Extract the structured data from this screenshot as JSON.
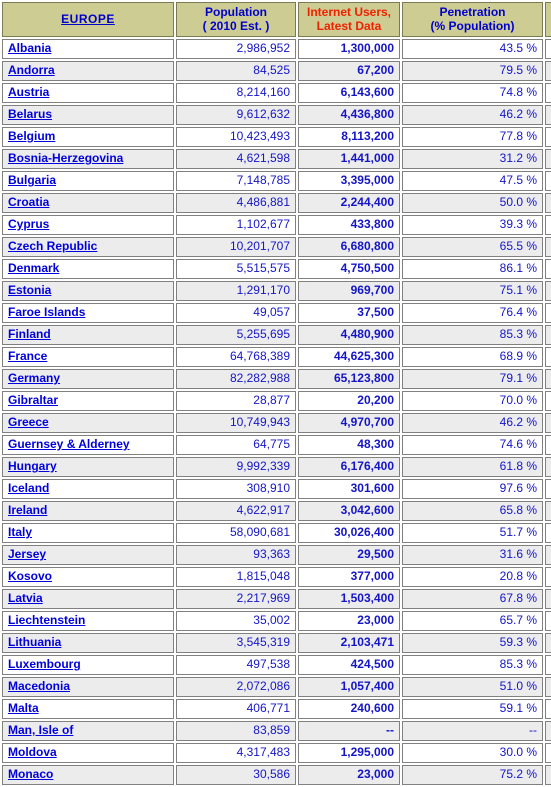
{
  "table": {
    "headers": {
      "region": "EUROPE",
      "population_line1": "Population",
      "population_line2": "( 2010 Est. )",
      "users_line1": "Internet Users,",
      "users_line2": "Latest Data",
      "penetration_line1": "Penetration",
      "penetration_line2": "(% Population)"
    },
    "colors": {
      "header_bg": "#cdcc93",
      "header_blue": "#0000cc",
      "header_red": "#ee2200",
      "link_blue": "#0000dd",
      "value_blue": "#2222cc",
      "alt_row_bg": "#ececec",
      "row_bg": "#ffffff",
      "border": "#808080"
    },
    "rows": [
      {
        "country": "Albania",
        "population": "2,986,952",
        "users": "1,300,000",
        "penetration": "43.5 %"
      },
      {
        "country": "Andorra",
        "population": "84,525",
        "users": "67,200",
        "penetration": "79.5 %"
      },
      {
        "country": "Austria",
        "population": "8,214,160",
        "users": "6,143,600",
        "penetration": "74.8 %"
      },
      {
        "country": "Belarus",
        "population": "9,612,632",
        "users": "4,436,800",
        "penetration": "46.2 %"
      },
      {
        "country": "Belgium",
        "population": "10,423,493",
        "users": "8,113,200",
        "penetration": "77.8 %"
      },
      {
        "country": "Bosnia-Herzegovina",
        "population": "4,621,598",
        "users": "1,441,000",
        "penetration": "31.2 %"
      },
      {
        "country": "Bulgaria",
        "population": "7,148,785",
        "users": "3,395,000",
        "penetration": "47.5 %"
      },
      {
        "country": "Croatia",
        "population": "4,486,881",
        "users": "2,244,400",
        "penetration": "50.0 %"
      },
      {
        "country": "Cyprus",
        "population": "1,102,677",
        "users": "433,800",
        "penetration": "39.3 %"
      },
      {
        "country": "Czech Republic",
        "population": "10,201,707",
        "users": "6,680,800",
        "penetration": "65.5 %"
      },
      {
        "country": "Denmark",
        "population": "5,515,575",
        "users": "4,750,500",
        "penetration": "86.1 %"
      },
      {
        "country": "Estonia",
        "population": "1,291,170",
        "users": "969,700",
        "penetration": "75.1 %"
      },
      {
        "country": "Faroe Islands",
        "population": "49,057",
        "users": "37,500",
        "penetration": "76.4 %"
      },
      {
        "country": "Finland",
        "population": "5,255,695",
        "users": "4,480,900",
        "penetration": "85.3 %"
      },
      {
        "country": "France",
        "population": "64,768,389",
        "users": "44,625,300",
        "penetration": "68.9 %"
      },
      {
        "country": "Germany",
        "population": "82,282,988",
        "users": "65,123,800",
        "penetration": "79.1 %"
      },
      {
        "country": "Gibraltar",
        "population": "28,877",
        "users": "20,200",
        "penetration": "70.0 %"
      },
      {
        "country": "Greece",
        "population": "10,749,943",
        "users": "4,970,700",
        "penetration": "46.2 %"
      },
      {
        "country": "Guernsey & Alderney",
        "population": "64,775",
        "users": "48,300",
        "penetration": "74.6 %"
      },
      {
        "country": "Hungary",
        "population": "9,992,339",
        "users": "6,176,400",
        "penetration": "61.8 %"
      },
      {
        "country": "Iceland",
        "population": "308,910",
        "users": "301,600",
        "penetration": "97.6 %"
      },
      {
        "country": "Ireland",
        "population": "4,622,917",
        "users": "3,042,600",
        "penetration": "65.8 %"
      },
      {
        "country": "Italy",
        "population": "58,090,681",
        "users": "30,026,400",
        "penetration": "51.7 %"
      },
      {
        "country": "Jersey",
        "population": "93,363",
        "users": "29,500",
        "penetration": "31.6 %"
      },
      {
        "country": "Kosovo",
        "population": "1,815,048",
        "users": "377,000",
        "penetration": "20.8 %"
      },
      {
        "country": "Latvia",
        "population": "2,217,969",
        "users": "1,503,400",
        "penetration": "67.8 %"
      },
      {
        "country": "Liechtenstein",
        "population": "35,002",
        "users": "23,000",
        "penetration": "65.7 %"
      },
      {
        "country": "Lithuania",
        "population": "3,545,319",
        "users": "2,103,471",
        "penetration": "59.3 %"
      },
      {
        "country": "Luxembourg",
        "population": "497,538",
        "users": "424,500",
        "penetration": "85.3 %"
      },
      {
        "country": "Macedonia",
        "population": "2,072,086",
        "users": "1,057,400",
        "penetration": "51.0 %"
      },
      {
        "country": "Malta",
        "population": "406,771",
        "users": "240,600",
        "penetration": "59.1 %"
      },
      {
        "country": "Man, Isle of",
        "population": "83,859",
        "users": "--",
        "penetration": "--"
      },
      {
        "country": "Moldova",
        "population": "4,317,483",
        "users": "1,295,000",
        "penetration": "30.0 %"
      },
      {
        "country": "Monaco",
        "population": "30,586",
        "users": "23,000",
        "penetration": "75.2 %"
      }
    ]
  }
}
